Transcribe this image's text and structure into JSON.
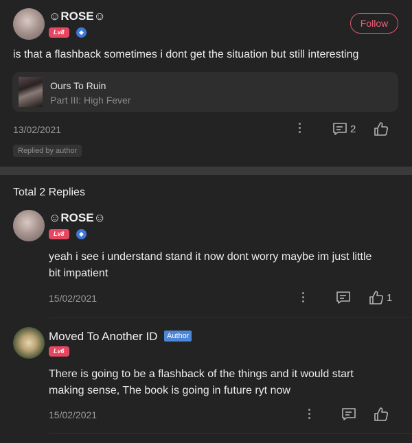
{
  "comment": {
    "username": "☺ROSE☺",
    "level": "Lv8",
    "verified_icon": "diamond-icon",
    "follow_label": "Follow",
    "text": "is that a flashback sometimes i dont get the situation but still interesting",
    "book": {
      "title": "Ours To Ruin",
      "chapter": "Part III: High Fever"
    },
    "date": "13/02/2021",
    "reply_count": "2",
    "replied_tag": "Replied by author"
  },
  "replies_header": "Total 2 Replies",
  "replies": [
    {
      "username": "☺ROSE☺",
      "level": "Lv8",
      "text_line1": "yeah i see i understand stand it now dont worry maybe im just little",
      "text_line2": "bit impatient",
      "date": "15/02/2021",
      "like_count": "1"
    },
    {
      "username": "Moved To Another ID",
      "author_tag": "Author",
      "level": "Lv6",
      "text_line1": "There is going to be a flashback of the things and it would start",
      "text_line2": "making sense, The book is going in future ryt now",
      "date": "15/02/2021"
    }
  ],
  "colors": {
    "background": "#232323",
    "accent_pink": "#e7475e",
    "verified_blue": "#3d78d8",
    "author_blue": "#4b86d8"
  }
}
